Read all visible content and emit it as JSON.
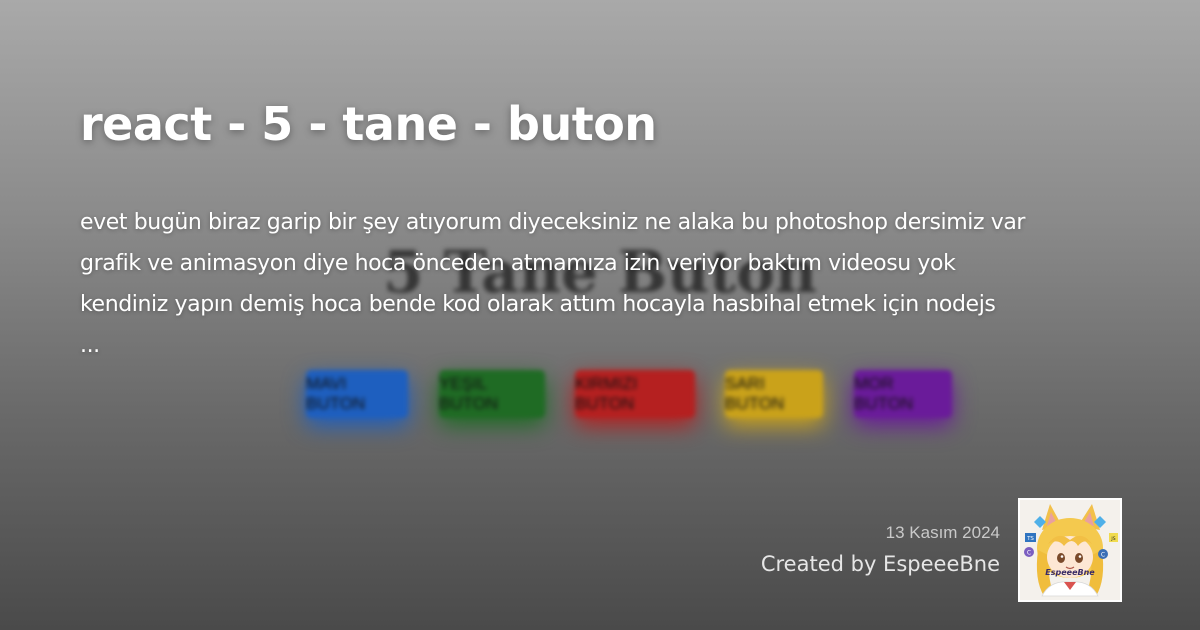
{
  "post": {
    "title": "react - 5 - tane - buton",
    "excerpt_lines": [
      "evet bugün biraz garip bir şey atıyorum diyeceksiniz ne alaka bu photoshop dersimiz var",
      "grafik ve animasyon diye hoca önceden atmamıza izin veriyor baktım videosu yok",
      "kendiniz yapın demiş hoca bende kod olarak attım hocayla hasbihal etmek için nodejs",
      "..."
    ],
    "date": "13 Kasım 2024",
    "author": "Created by EspeeeBne"
  },
  "background_preview": {
    "heading": "5 Tane Buton",
    "buttons": [
      {
        "label": "MAVI BUTON",
        "color": "#1e5fbf"
      },
      {
        "label": "YEŞIL BUTON",
        "color": "#1f6b24"
      },
      {
        "label": "KIRMIZI BUTON",
        "color": "#b52020"
      },
      {
        "label": "SARI BUTON",
        "color": "#caa21a"
      },
      {
        "label": "MOR BUTON",
        "color": "#6a1b9a"
      }
    ]
  },
  "avatar": {
    "caption": "EspeeeBne",
    "badges": [
      "TS",
      "JS",
      "C",
      "C"
    ]
  }
}
